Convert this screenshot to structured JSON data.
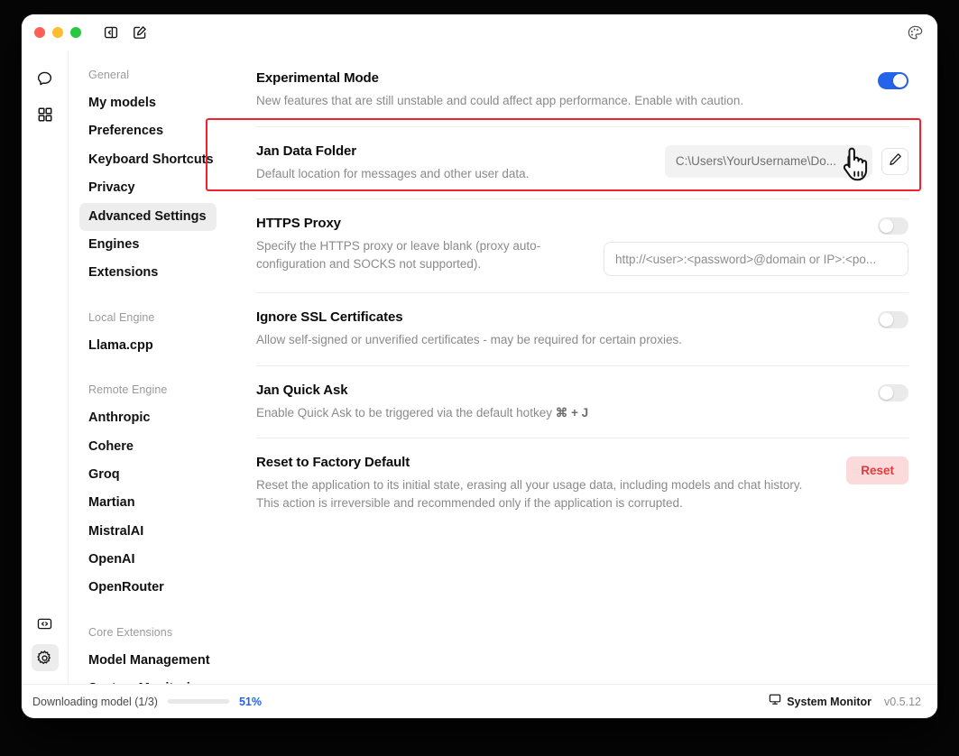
{
  "window": {
    "traffic_lights": [
      "close",
      "minimize",
      "maximize"
    ],
    "titlebar_icons": [
      "panel-collapse-icon",
      "new-note-icon"
    ],
    "titlebar_right_icon": "palette-icon"
  },
  "rail": {
    "top_items": [
      {
        "name": "chat-icon",
        "label": "Chat"
      },
      {
        "name": "hub-icon",
        "label": "Hub"
      }
    ],
    "bottom_items": [
      {
        "name": "code-icon",
        "label": "Local API Server",
        "active": false
      },
      {
        "name": "gear-icon",
        "label": "Settings",
        "active": true
      }
    ]
  },
  "sidebar": {
    "groups": [
      {
        "title": "General",
        "items": [
          {
            "label": "My models",
            "active": false
          },
          {
            "label": "Preferences",
            "active": false
          },
          {
            "label": "Keyboard Shortcuts",
            "active": false
          },
          {
            "label": "Privacy",
            "active": false
          },
          {
            "label": "Advanced Settings",
            "active": true
          },
          {
            "label": "Engines",
            "active": false
          },
          {
            "label": "Extensions",
            "active": false
          }
        ]
      },
      {
        "title": "Local Engine",
        "items": [
          {
            "label": "Llama.cpp",
            "active": false
          }
        ]
      },
      {
        "title": "Remote Engine",
        "items": [
          {
            "label": "Anthropic",
            "active": false
          },
          {
            "label": "Cohere",
            "active": false
          },
          {
            "label": "Groq",
            "active": false
          },
          {
            "label": "Martian",
            "active": false
          },
          {
            "label": "MistralAI",
            "active": false
          },
          {
            "label": "OpenAI",
            "active": false
          },
          {
            "label": "OpenRouter",
            "active": false
          }
        ]
      },
      {
        "title": "Core Extensions",
        "items": [
          {
            "label": "Model Management",
            "active": false
          },
          {
            "label": "System Monitoring",
            "active": false
          }
        ]
      }
    ]
  },
  "settings": {
    "experimental_mode": {
      "title": "Experimental Mode",
      "description": "New features that are still unstable and could affect app performance. Enable with caution.",
      "toggle_state": "on"
    },
    "jan_data_folder": {
      "title": "Jan Data Folder",
      "description": "Default location for messages and other user data.",
      "path_value": "C:\\Users\\YourUsername\\Do...",
      "folder_icon": "folder-open-icon",
      "edit_icon": "pencil-icon"
    },
    "https_proxy": {
      "title": "HTTPS Proxy",
      "description": "Specify the HTTPS proxy or leave blank (proxy auto-configuration and SOCKS not supported).",
      "toggle_state": "off",
      "input_value": "",
      "input_placeholder": "http://<user>:<password>@domain or IP>:<po..."
    },
    "ignore_ssl": {
      "title": "Ignore SSL Certificates",
      "description": "Allow self-signed or unverified certificates - may be required for certain proxies.",
      "toggle_state": "off"
    },
    "quick_ask": {
      "title": "Jan Quick Ask",
      "description_prefix": "Enable Quick Ask to be triggered via the default hotkey ",
      "hotkey": "⌘ + J",
      "toggle_state": "off"
    },
    "factory_reset": {
      "title": "Reset to Factory Default",
      "description": "Reset the application to its initial state, erasing all your usage data, including models and chat history. This action is irreversible and recommended only if the application is corrupted.",
      "button_label": "Reset"
    }
  },
  "statusbar": {
    "download_text": "Downloading model (1/3)",
    "progress_percent": 51,
    "progress_label": "51%",
    "system_monitor_label": "System Monitor",
    "system_monitor_icon": "monitor-icon",
    "version": "v0.5.12"
  },
  "annotation": {
    "highlight_color": "#f5222d",
    "target": "jan-data-folder-row"
  },
  "colors": {
    "accent_blue": "#2563eb",
    "danger_red": "#e23b3b",
    "danger_bg": "#fadadb",
    "highlight_red": "#f5222d"
  }
}
